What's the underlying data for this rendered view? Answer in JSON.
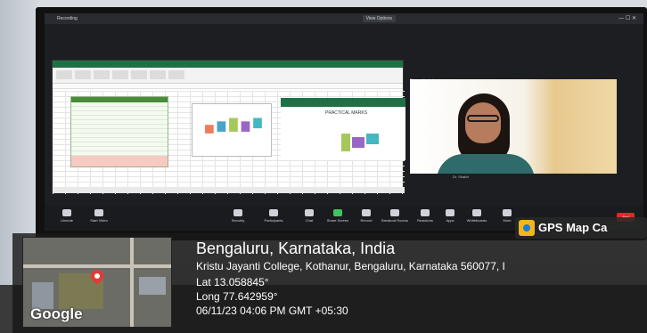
{
  "zoom": {
    "title": "Recording",
    "recording_badge": "View Options",
    "participant_name": "Ramya Nyakol",
    "participant_label": "Dr. Shalini",
    "toolbar": [
      {
        "label": "Unmute"
      },
      {
        "label": "Start Video"
      },
      {
        "label": "Security"
      },
      {
        "label": "Participants"
      },
      {
        "label": "Chat"
      },
      {
        "label": "Share Screen"
      },
      {
        "label": "Record"
      },
      {
        "label": "Breakout Rooms"
      },
      {
        "label": "Reactions"
      },
      {
        "label": "Apps"
      },
      {
        "label": "Whiteboards"
      },
      {
        "label": "More"
      }
    ],
    "end_label": "End"
  },
  "spreadsheet": {
    "chart_title": "PRACTICAL MARKS"
  },
  "gps": {
    "app_name": "GPS Map Ca",
    "map_label": "Google",
    "location_title": "Bengaluru, Karnataka, India",
    "address": "Kristu Jayanti College, Kothanur, Bengaluru, Karnataka 560077, I",
    "lat": "Lat 13.058845°",
    "long": "Long 77.642959°",
    "datetime": "06/11/23 04:06 PM GMT +05:30"
  }
}
